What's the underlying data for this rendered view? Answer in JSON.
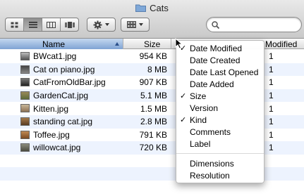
{
  "window": {
    "title": "Cats",
    "search_placeholder": ""
  },
  "columns": {
    "name": "Name",
    "size": "Size",
    "date_modified": "Modified"
  },
  "files": [
    {
      "name": "BWcat1.jpg",
      "size": "954 KB",
      "date_modified": "1"
    },
    {
      "name": "Cat on piano.jpg",
      "size": "8 MB",
      "date_modified": "1"
    },
    {
      "name": "CatFromOldBar.jpg",
      "size": "907 KB",
      "date_modified": "1"
    },
    {
      "name": "GardenCat.jpg",
      "size": "5.1 MB",
      "date_modified": "1"
    },
    {
      "name": "Kitten.jpg",
      "size": "1.5 MB",
      "date_modified": "1"
    },
    {
      "name": "standing cat.jpg",
      "size": "2.8 MB",
      "date_modified": "1"
    },
    {
      "name": "Toffee.jpg",
      "size": "791 KB",
      "date_modified": "1"
    },
    {
      "name": "willowcat.jpg",
      "size": "720 KB",
      "date_modified": "1"
    }
  ],
  "column_menu": {
    "check_glyph": "✓",
    "items": [
      {
        "label": "Date Modified",
        "checked": true
      },
      {
        "label": "Date Created",
        "checked": false
      },
      {
        "label": "Date Last Opened",
        "checked": false
      },
      {
        "label": "Date Added",
        "checked": false
      },
      {
        "label": "Size",
        "checked": true
      },
      {
        "label": "Version",
        "checked": false
      },
      {
        "label": "Kind",
        "checked": true
      },
      {
        "label": "Comments",
        "checked": false
      },
      {
        "label": "Label",
        "checked": false
      }
    ],
    "extra_items": [
      {
        "label": "Dimensions",
        "checked": false
      },
      {
        "label": "Resolution",
        "checked": false
      }
    ]
  },
  "icons": {
    "folder": "folder-icon",
    "view_icon": "icon-view-icon",
    "view_list": "list-view-icon",
    "view_columns": "column-view-icon",
    "view_coverflow": "coverflow-view-icon",
    "action": "gear-icon",
    "arrange": "arrange-grid-icon",
    "search": "search-icon"
  },
  "colors": {
    "selected_column": "#7fa3d3",
    "row_stripe": "#edf3fe"
  }
}
